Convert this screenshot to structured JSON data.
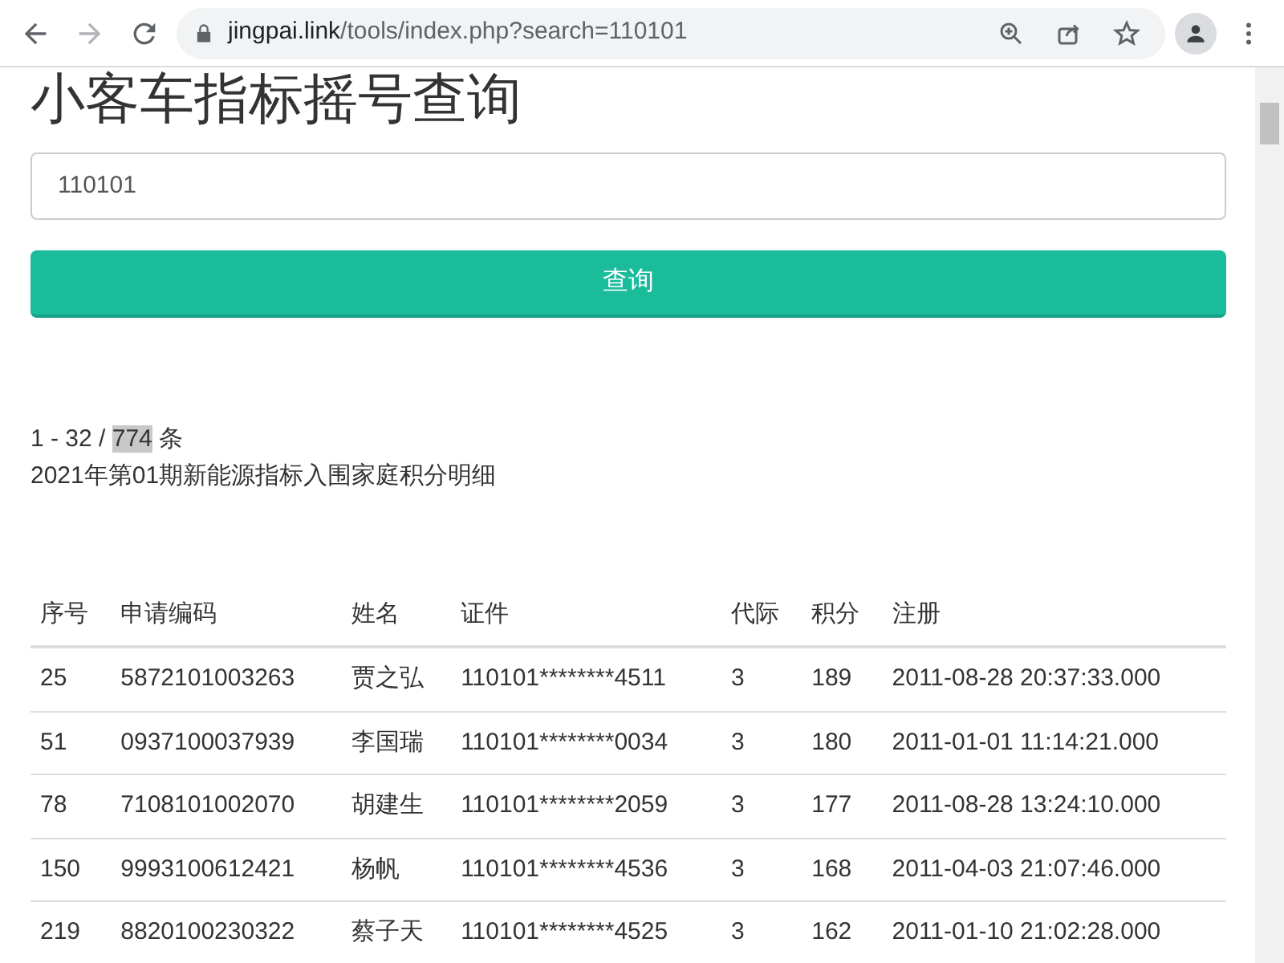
{
  "browser": {
    "url_host": "jingpai.link",
    "url_path": "/tools/index.php?search=110101"
  },
  "page": {
    "title": "小客车指标摇号查询",
    "search": {
      "value": "110101"
    },
    "search_button": "查询",
    "summary": {
      "range": "1 - 32 /",
      "total": "774",
      "total_highlighted": true,
      "unit": "条"
    },
    "subtitle": "2021年第01期新能源指标入围家庭积分明细",
    "table": {
      "columns": [
        "序号",
        "申请编码",
        "姓名",
        "证件",
        "代际",
        "积分",
        "注册"
      ],
      "rows": [
        [
          "25",
          "5872101003263",
          "贾之弘",
          "110101********4511",
          "3",
          "189",
          "2011-08-28 20:37:33.000"
        ],
        [
          "51",
          "0937100037939",
          "李国瑞",
          "110101********0034",
          "3",
          "180",
          "2011-01-01 11:14:21.000"
        ],
        [
          "78",
          "7108101002070",
          "胡建生",
          "110101********2059",
          "3",
          "177",
          "2011-08-28 13:24:10.000"
        ],
        [
          "150",
          "9993100612421",
          "杨帆",
          "110101********4536",
          "3",
          "168",
          "2011-04-03 21:07:46.000"
        ],
        [
          "219",
          "8820100230322",
          "蔡子天",
          "110101********4525",
          "3",
          "162",
          "2011-01-10 21:02:28.000"
        ]
      ]
    }
  }
}
